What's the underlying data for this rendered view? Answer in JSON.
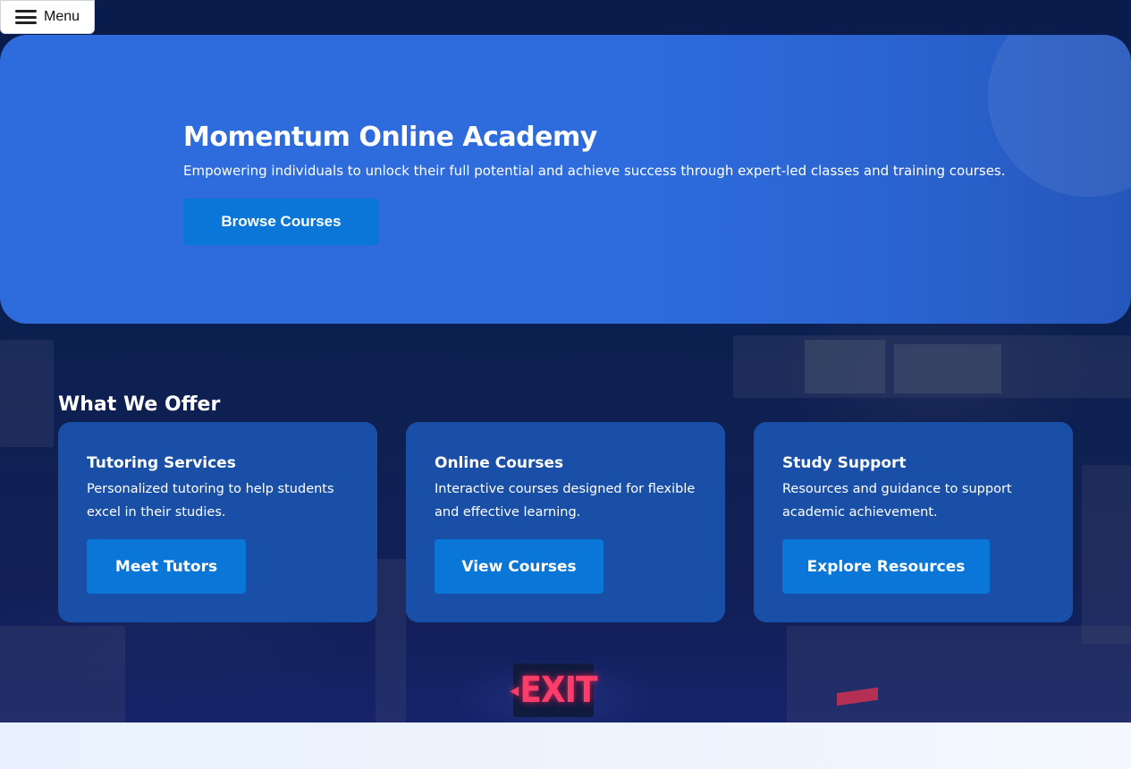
{
  "menu": {
    "label": "Menu",
    "icon": "hamburger-icon"
  },
  "hero": {
    "title": "Momentum Online Academy",
    "subtitle": "Empowering individuals to unlock their full potential and achieve success through expert-led classes and training courses.",
    "cta_label": "Browse Courses"
  },
  "offer": {
    "title": "What We Offer",
    "cards": [
      {
        "title": "Tutoring Services",
        "description": "Personalized tutoring to help students excel in their studies.",
        "button_label": "Meet Tutors"
      },
      {
        "title": "Online Courses",
        "description": "Interactive courses designed for flexible and effective learning.",
        "button_label": "View Courses"
      },
      {
        "title": "Study Support",
        "description": "Resources and guidance to support academic achievement.",
        "button_label": "Explore Resources"
      }
    ]
  },
  "background": {
    "sign_text": "EXIT"
  },
  "colors": {
    "hero_blue": "#2e6cde",
    "button_blue": "#0a76d8",
    "card_blue": "#1a4fa8",
    "background_navy": "#0b1d4d"
  }
}
